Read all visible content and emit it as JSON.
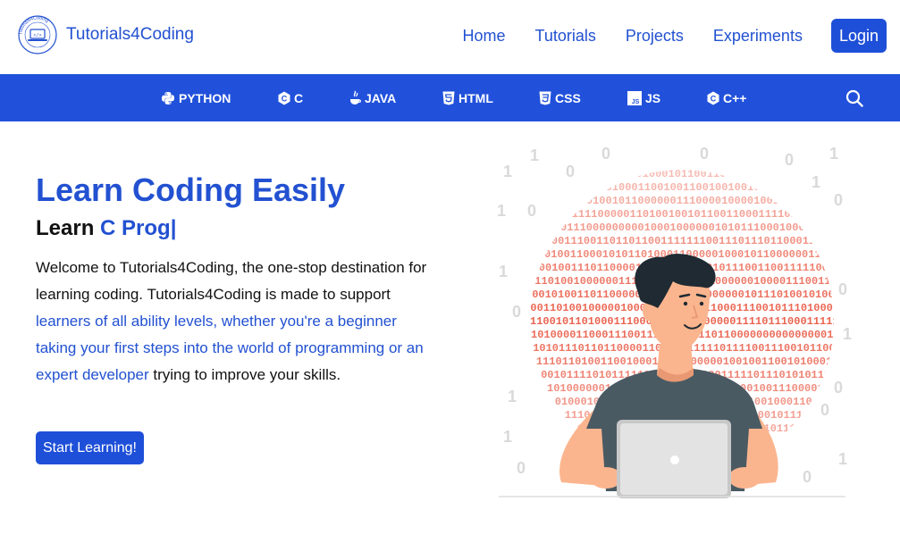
{
  "header": {
    "brand": "Tutorials4Coding",
    "logo_ring_text": "Tutorials4Coding",
    "logo_icon": "code-laptop-icon",
    "nav": [
      {
        "label": "Home"
      },
      {
        "label": "Tutorials"
      },
      {
        "label": "Projects"
      },
      {
        "label": "Experiments"
      }
    ],
    "login_label": "Login"
  },
  "langbar": {
    "items": [
      {
        "label": "PYTHON",
        "icon": "python-icon"
      },
      {
        "label": "C",
        "icon": "c-icon"
      },
      {
        "label": "JAVA",
        "icon": "java-icon"
      },
      {
        "label": "HTML",
        "icon": "html5-icon"
      },
      {
        "label": "CSS",
        "icon": "css3-icon"
      },
      {
        "label": "JS",
        "icon": "js-icon"
      },
      {
        "label": "C++",
        "icon": "cplusplus-icon"
      }
    ],
    "search_icon": "search-icon"
  },
  "hero": {
    "title": "Learn Coding Easily",
    "subtitle_prefix": "Learn",
    "subtitle_typed": "C Prog|",
    "text_part1": "Welcome to Tutorials4Coding, the one-stop destination for learning coding. Tutorials4Coding is made to support ",
    "text_highlight": "learners of all ability levels, whether you're a beginner taking your first steps into the world of programming or an expert developer",
    "text_part2": " trying to improve your skills.",
    "cta_label": "Start Learning!"
  },
  "colors": {
    "brand_blue": "#2251d1",
    "langbar_bg": "#2151db",
    "binary_red": "#e8503a",
    "skin": "#fbb58e",
    "shirt": "#4a5a63",
    "hair": "#1f2a33"
  }
}
